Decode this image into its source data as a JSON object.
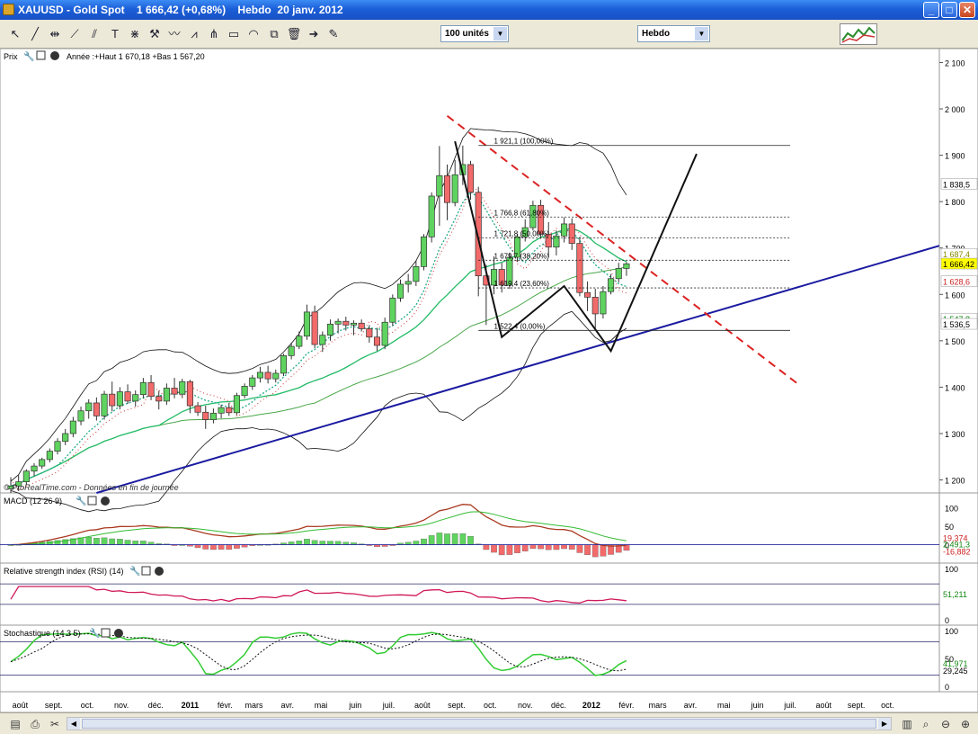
{
  "window": {
    "title": "XAUUSD - Gold Spot    1 666,42 (+0,68%)    Hebdo  20 janv. 2012",
    "buttons": [
      "_",
      "□",
      "✕"
    ]
  },
  "toolbar": {
    "icons": [
      "cursor-icon",
      "line-icon",
      "hline-icon",
      "trend-icon",
      "channel-icon",
      "text-icon",
      "fibo-fan-icon",
      "tools-icon",
      "wave-icon",
      "pattern-icon",
      "pitchfork-icon",
      "rectangle-icon",
      "cycle-icon",
      "copy-icon",
      "trash-icon",
      "arrow-icon",
      "magic-icon"
    ],
    "units_select": "100 unités",
    "period_select": "Hebdo"
  },
  "price_panel": {
    "label": "Prix",
    "info": "Année :+Haut 1 670,18 +Bas 1 567,20",
    "watermark": "© ProRealTime.com - Données en fin de journée",
    "y_ticks": [
      {
        "v": 2100,
        "t": "2 100"
      },
      {
        "v": 2000,
        "t": "2 000"
      },
      {
        "v": 1900,
        "t": "1 900"
      },
      {
        "v": 1800,
        "t": "1 800"
      },
      {
        "v": 1700,
        "t": "1 700"
      },
      {
        "v": 1600,
        "t": "1 600"
      },
      {
        "v": 1500,
        "t": "1 500"
      },
      {
        "v": 1400,
        "t": "1 400"
      },
      {
        "v": 1300,
        "t": "1 300"
      },
      {
        "v": 1200,
        "t": "1 200"
      }
    ],
    "y_range": [
      1172,
      2130
    ],
    "price_tags": [
      {
        "v": 1838.5,
        "t": "1 838,5",
        "color": "#000000",
        "bg": "#ffffff"
      },
      {
        "v": 1687.4,
        "t": "1 687,4",
        "color": "#8a8a00",
        "bg": "#ffffff"
      },
      {
        "v": 1666.42,
        "t": "1 666,42",
        "color": "#000000",
        "bg": "#ffff00"
      },
      {
        "v": 1628.6,
        "t": "1 628,6",
        "color": "#cc2222",
        "bg": "#ffffff"
      },
      {
        "v": 1547.8,
        "t": "1 547,8",
        "color": "#118811",
        "bg": "#ffffff"
      },
      {
        "v": 1536.5,
        "t": "1 536,5",
        "color": "#000000",
        "bg": "#ffffff"
      }
    ],
    "fibonacci": [
      {
        "v": 1921.1,
        "t": "1 921,1 (100,00%)"
      },
      {
        "v": 1766.8,
        "t": "1 766,8 (61,80%)"
      },
      {
        "v": 1721.8,
        "t": "1 721,8 (50,00%)"
      },
      {
        "v": 1673.7,
        "t": "1 679,7 (38,20%)"
      },
      {
        "v": 1614,
        "t": "1 619,4 (23,60%)"
      },
      {
        "v": 1522.4,
        "t": "1 522,4 (0,00%)"
      }
    ]
  },
  "macd_panel": {
    "label": "MACD (12 26 9)",
    "y_range": [
      -35,
      125
    ],
    "ticks": [
      {
        "v": 100,
        "t": "100"
      },
      {
        "v": 50,
        "t": "50"
      },
      {
        "v": 0,
        "t": "0"
      }
    ],
    "tags": [
      {
        "v": 19.374,
        "t": "19,374",
        "color": "#cc2222"
      },
      {
        "v": 2.491,
        "t": "2,491,3",
        "color": "#118811"
      },
      {
        "v": -16.882,
        "t": "-16,882",
        "color": "#cc2222"
      }
    ]
  },
  "rsi_panel": {
    "label": "Relative strength index (RSI) (14)",
    "y_range": [
      0,
      100
    ],
    "ticks": [
      {
        "v": 100,
        "t": "100"
      },
      {
        "v": 0,
        "t": "0"
      }
    ],
    "tags": [
      {
        "v": 51.211,
        "t": "51,211",
        "color": "#118811"
      }
    ]
  },
  "stoch_panel": {
    "label": "Stochastique (14 3 5)",
    "y_range": [
      0,
      100
    ],
    "ticks": [
      {
        "v": 100,
        "t": "100"
      },
      {
        "v": 50,
        "t": "50"
      },
      {
        "v": 0,
        "t": "0"
      }
    ],
    "tags": [
      {
        "v": 41.971,
        "t": "41,971",
        "color": "#118811"
      },
      {
        "v": 29.245,
        "t": "29,245",
        "color": "#000000"
      }
    ]
  },
  "x_axis": {
    "month_labels": [
      {
        "i": 1.2,
        "t": "août"
      },
      {
        "i": 5.5,
        "t": "sept."
      },
      {
        "i": 9.8,
        "t": "oct."
      },
      {
        "i": 14.2,
        "t": "nov."
      },
      {
        "i": 18.6,
        "t": "déc."
      },
      {
        "i": 23,
        "t": "2011",
        "bold": true
      },
      {
        "i": 27.5,
        "t": "févr."
      },
      {
        "i": 31.2,
        "t": "mars"
      },
      {
        "i": 35.5,
        "t": "avr."
      },
      {
        "i": 39.8,
        "t": "mai"
      },
      {
        "i": 44.2,
        "t": "juin"
      },
      {
        "i": 48.5,
        "t": "juil."
      },
      {
        "i": 52.8,
        "t": "août"
      },
      {
        "i": 57.2,
        "t": "sept."
      },
      {
        "i": 61.5,
        "t": "oct."
      },
      {
        "i": 66,
        "t": "nov."
      },
      {
        "i": 70.3,
        "t": "déc."
      },
      {
        "i": 74.5,
        "t": "2012",
        "bold": true
      },
      {
        "i": 79,
        "t": "févr."
      },
      {
        "i": 83,
        "t": "mars"
      },
      {
        "i": 87.2,
        "t": "avr."
      },
      {
        "i": 91.5,
        "t": "mai"
      },
      {
        "i": 95.8,
        "t": "juin"
      },
      {
        "i": 100,
        "t": "juil."
      },
      {
        "i": 104.3,
        "t": "août"
      },
      {
        "i": 108.5,
        "t": "sept."
      },
      {
        "i": 112.5,
        "t": "oct."
      }
    ]
  },
  "chart_data": {
    "type": "candlestick",
    "title": "XAUUSD - Gold Spot",
    "period": "Hebdo",
    "candles": [
      {
        "o": 1181,
        "h": 1206,
        "l": 1172,
        "c": 1187
      },
      {
        "o": 1187,
        "h": 1210,
        "l": 1176,
        "c": 1196
      },
      {
        "o": 1196,
        "h": 1223,
        "l": 1190,
        "c": 1219
      },
      {
        "o": 1219,
        "h": 1236,
        "l": 1208,
        "c": 1230
      },
      {
        "o": 1230,
        "h": 1248,
        "l": 1224,
        "c": 1244
      },
      {
        "o": 1244,
        "h": 1268,
        "l": 1238,
        "c": 1262
      },
      {
        "o": 1262,
        "h": 1290,
        "l": 1255,
        "c": 1283
      },
      {
        "o": 1283,
        "h": 1310,
        "l": 1275,
        "c": 1300
      },
      {
        "o": 1300,
        "h": 1336,
        "l": 1292,
        "c": 1327
      },
      {
        "o": 1327,
        "h": 1358,
        "l": 1318,
        "c": 1349
      },
      {
        "o": 1349,
        "h": 1374,
        "l": 1332,
        "c": 1366
      },
      {
        "o": 1366,
        "h": 1378,
        "l": 1328,
        "c": 1338
      },
      {
        "o": 1338,
        "h": 1392,
        "l": 1330,
        "c": 1385
      },
      {
        "o": 1385,
        "h": 1412,
        "l": 1348,
        "c": 1360
      },
      {
        "o": 1360,
        "h": 1400,
        "l": 1352,
        "c": 1390
      },
      {
        "o": 1390,
        "h": 1406,
        "l": 1364,
        "c": 1370
      },
      {
        "o": 1370,
        "h": 1393,
        "l": 1358,
        "c": 1384
      },
      {
        "o": 1384,
        "h": 1420,
        "l": 1376,
        "c": 1410
      },
      {
        "o": 1410,
        "h": 1426,
        "l": 1372,
        "c": 1380
      },
      {
        "o": 1380,
        "h": 1392,
        "l": 1352,
        "c": 1370
      },
      {
        "o": 1370,
        "h": 1408,
        "l": 1362,
        "c": 1398
      },
      {
        "o": 1398,
        "h": 1420,
        "l": 1376,
        "c": 1385
      },
      {
        "o": 1385,
        "h": 1418,
        "l": 1378,
        "c": 1412
      },
      {
        "o": 1412,
        "h": 1416,
        "l": 1344,
        "c": 1360
      },
      {
        "o": 1360,
        "h": 1368,
        "l": 1338,
        "c": 1346
      },
      {
        "o": 1346,
        "h": 1360,
        "l": 1310,
        "c": 1330
      },
      {
        "o": 1330,
        "h": 1354,
        "l": 1322,
        "c": 1344
      },
      {
        "o": 1344,
        "h": 1362,
        "l": 1333,
        "c": 1356
      },
      {
        "o": 1356,
        "h": 1366,
        "l": 1338,
        "c": 1345
      },
      {
        "o": 1345,
        "h": 1388,
        "l": 1340,
        "c": 1382
      },
      {
        "o": 1382,
        "h": 1408,
        "l": 1376,
        "c": 1402
      },
      {
        "o": 1402,
        "h": 1426,
        "l": 1394,
        "c": 1420
      },
      {
        "o": 1420,
        "h": 1444,
        "l": 1410,
        "c": 1432
      },
      {
        "o": 1432,
        "h": 1446,
        "l": 1408,
        "c": 1418
      },
      {
        "o": 1418,
        "h": 1438,
        "l": 1410,
        "c": 1430
      },
      {
        "o": 1430,
        "h": 1472,
        "l": 1424,
        "c": 1468
      },
      {
        "o": 1468,
        "h": 1496,
        "l": 1460,
        "c": 1488
      },
      {
        "o": 1488,
        "h": 1520,
        "l": 1482,
        "c": 1510
      },
      {
        "o": 1510,
        "h": 1578,
        "l": 1502,
        "c": 1562
      },
      {
        "o": 1562,
        "h": 1576,
        "l": 1484,
        "c": 1492
      },
      {
        "o": 1492,
        "h": 1520,
        "l": 1476,
        "c": 1512
      },
      {
        "o": 1512,
        "h": 1546,
        "l": 1500,
        "c": 1536
      },
      {
        "o": 1536,
        "h": 1548,
        "l": 1516,
        "c": 1542
      },
      {
        "o": 1542,
        "h": 1552,
        "l": 1522,
        "c": 1534
      },
      {
        "o": 1534,
        "h": 1544,
        "l": 1512,
        "c": 1538
      },
      {
        "o": 1538,
        "h": 1546,
        "l": 1520,
        "c": 1526
      },
      {
        "o": 1526,
        "h": 1534,
        "l": 1496,
        "c": 1508
      },
      {
        "o": 1508,
        "h": 1528,
        "l": 1478,
        "c": 1490
      },
      {
        "o": 1490,
        "h": 1550,
        "l": 1482,
        "c": 1540
      },
      {
        "o": 1540,
        "h": 1600,
        "l": 1532,
        "c": 1592
      },
      {
        "o": 1592,
        "h": 1632,
        "l": 1584,
        "c": 1622
      },
      {
        "o": 1622,
        "h": 1644,
        "l": 1604,
        "c": 1628
      },
      {
        "o": 1628,
        "h": 1672,
        "l": 1618,
        "c": 1660
      },
      {
        "o": 1660,
        "h": 1730,
        "l": 1652,
        "c": 1724
      },
      {
        "o": 1724,
        "h": 1820,
        "l": 1712,
        "c": 1812
      },
      {
        "o": 1812,
        "h": 1920,
        "l": 1748,
        "c": 1856
      },
      {
        "o": 1856,
        "h": 1880,
        "l": 1760,
        "c": 1798
      },
      {
        "o": 1798,
        "h": 1890,
        "l": 1790,
        "c": 1858
      },
      {
        "o": 1858,
        "h": 1921,
        "l": 1836,
        "c": 1880
      },
      {
        "o": 1880,
        "h": 1888,
        "l": 1804,
        "c": 1820
      },
      {
        "o": 1820,
        "h": 1832,
        "l": 1596,
        "c": 1640
      },
      {
        "o": 1640,
        "h": 1664,
        "l": 1534,
        "c": 1620
      },
      {
        "o": 1620,
        "h": 1682,
        "l": 1600,
        "c": 1654
      },
      {
        "o": 1654,
        "h": 1668,
        "l": 1604,
        "c": 1620
      },
      {
        "o": 1620,
        "h": 1690,
        "l": 1612,
        "c": 1680
      },
      {
        "o": 1680,
        "h": 1730,
        "l": 1670,
        "c": 1724
      },
      {
        "o": 1724,
        "h": 1762,
        "l": 1714,
        "c": 1744
      },
      {
        "o": 1744,
        "h": 1802,
        "l": 1738,
        "c": 1792
      },
      {
        "o": 1792,
        "h": 1804,
        "l": 1720,
        "c": 1730
      },
      {
        "o": 1730,
        "h": 1756,
        "l": 1680,
        "c": 1702
      },
      {
        "o": 1702,
        "h": 1738,
        "l": 1684,
        "c": 1726
      },
      {
        "o": 1726,
        "h": 1766,
        "l": 1712,
        "c": 1752
      },
      {
        "o": 1752,
        "h": 1764,
        "l": 1696,
        "c": 1710
      },
      {
        "o": 1710,
        "h": 1724,
        "l": 1596,
        "c": 1604
      },
      {
        "o": 1604,
        "h": 1628,
        "l": 1564,
        "c": 1594
      },
      {
        "o": 1594,
        "h": 1612,
        "l": 1522,
        "c": 1558
      },
      {
        "o": 1558,
        "h": 1618,
        "l": 1548,
        "c": 1606
      },
      {
        "o": 1606,
        "h": 1644,
        "l": 1600,
        "c": 1634
      },
      {
        "o": 1634,
        "h": 1668,
        "l": 1626,
        "c": 1656
      },
      {
        "o": 1656,
        "h": 1670,
        "l": 1640,
        "c": 1666
      }
    ]
  }
}
